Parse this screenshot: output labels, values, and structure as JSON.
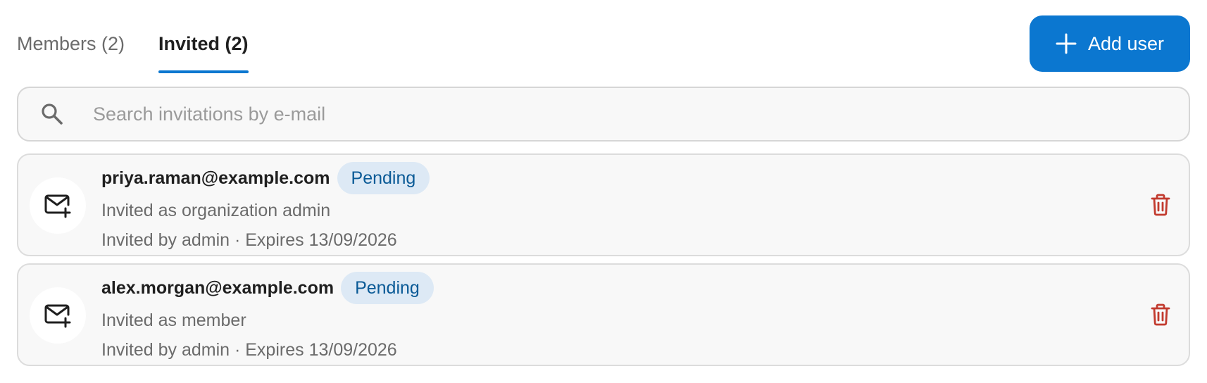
{
  "colors": {
    "accent": "#0b77d0",
    "delete": "#c23b2f",
    "badge_bg": "#dde9f5",
    "badge_text": "#0a5a96"
  },
  "tabs": [
    {
      "label": "Members (2)",
      "active": false
    },
    {
      "label": "Invited (2)",
      "active": true
    }
  ],
  "add_user_button": {
    "label": "Add user",
    "icon": "plus-icon"
  },
  "search": {
    "placeholder": "Search invitations by e-mail",
    "value": "",
    "icon": "search-icon"
  },
  "invitations": [
    {
      "email": "priya.raman@example.com",
      "status": "Pending",
      "role_text": "Invited as organization admin",
      "meta_text": "Invited by admin · Expires 13/09/2026",
      "icon": "mail-plus-icon",
      "action_icon": "trash-icon"
    },
    {
      "email": "alex.morgan@example.com",
      "status": "Pending",
      "role_text": "Invited as member",
      "meta_text": "Invited by admin · Expires 13/09/2026",
      "icon": "mail-plus-icon",
      "action_icon": "trash-icon"
    }
  ]
}
